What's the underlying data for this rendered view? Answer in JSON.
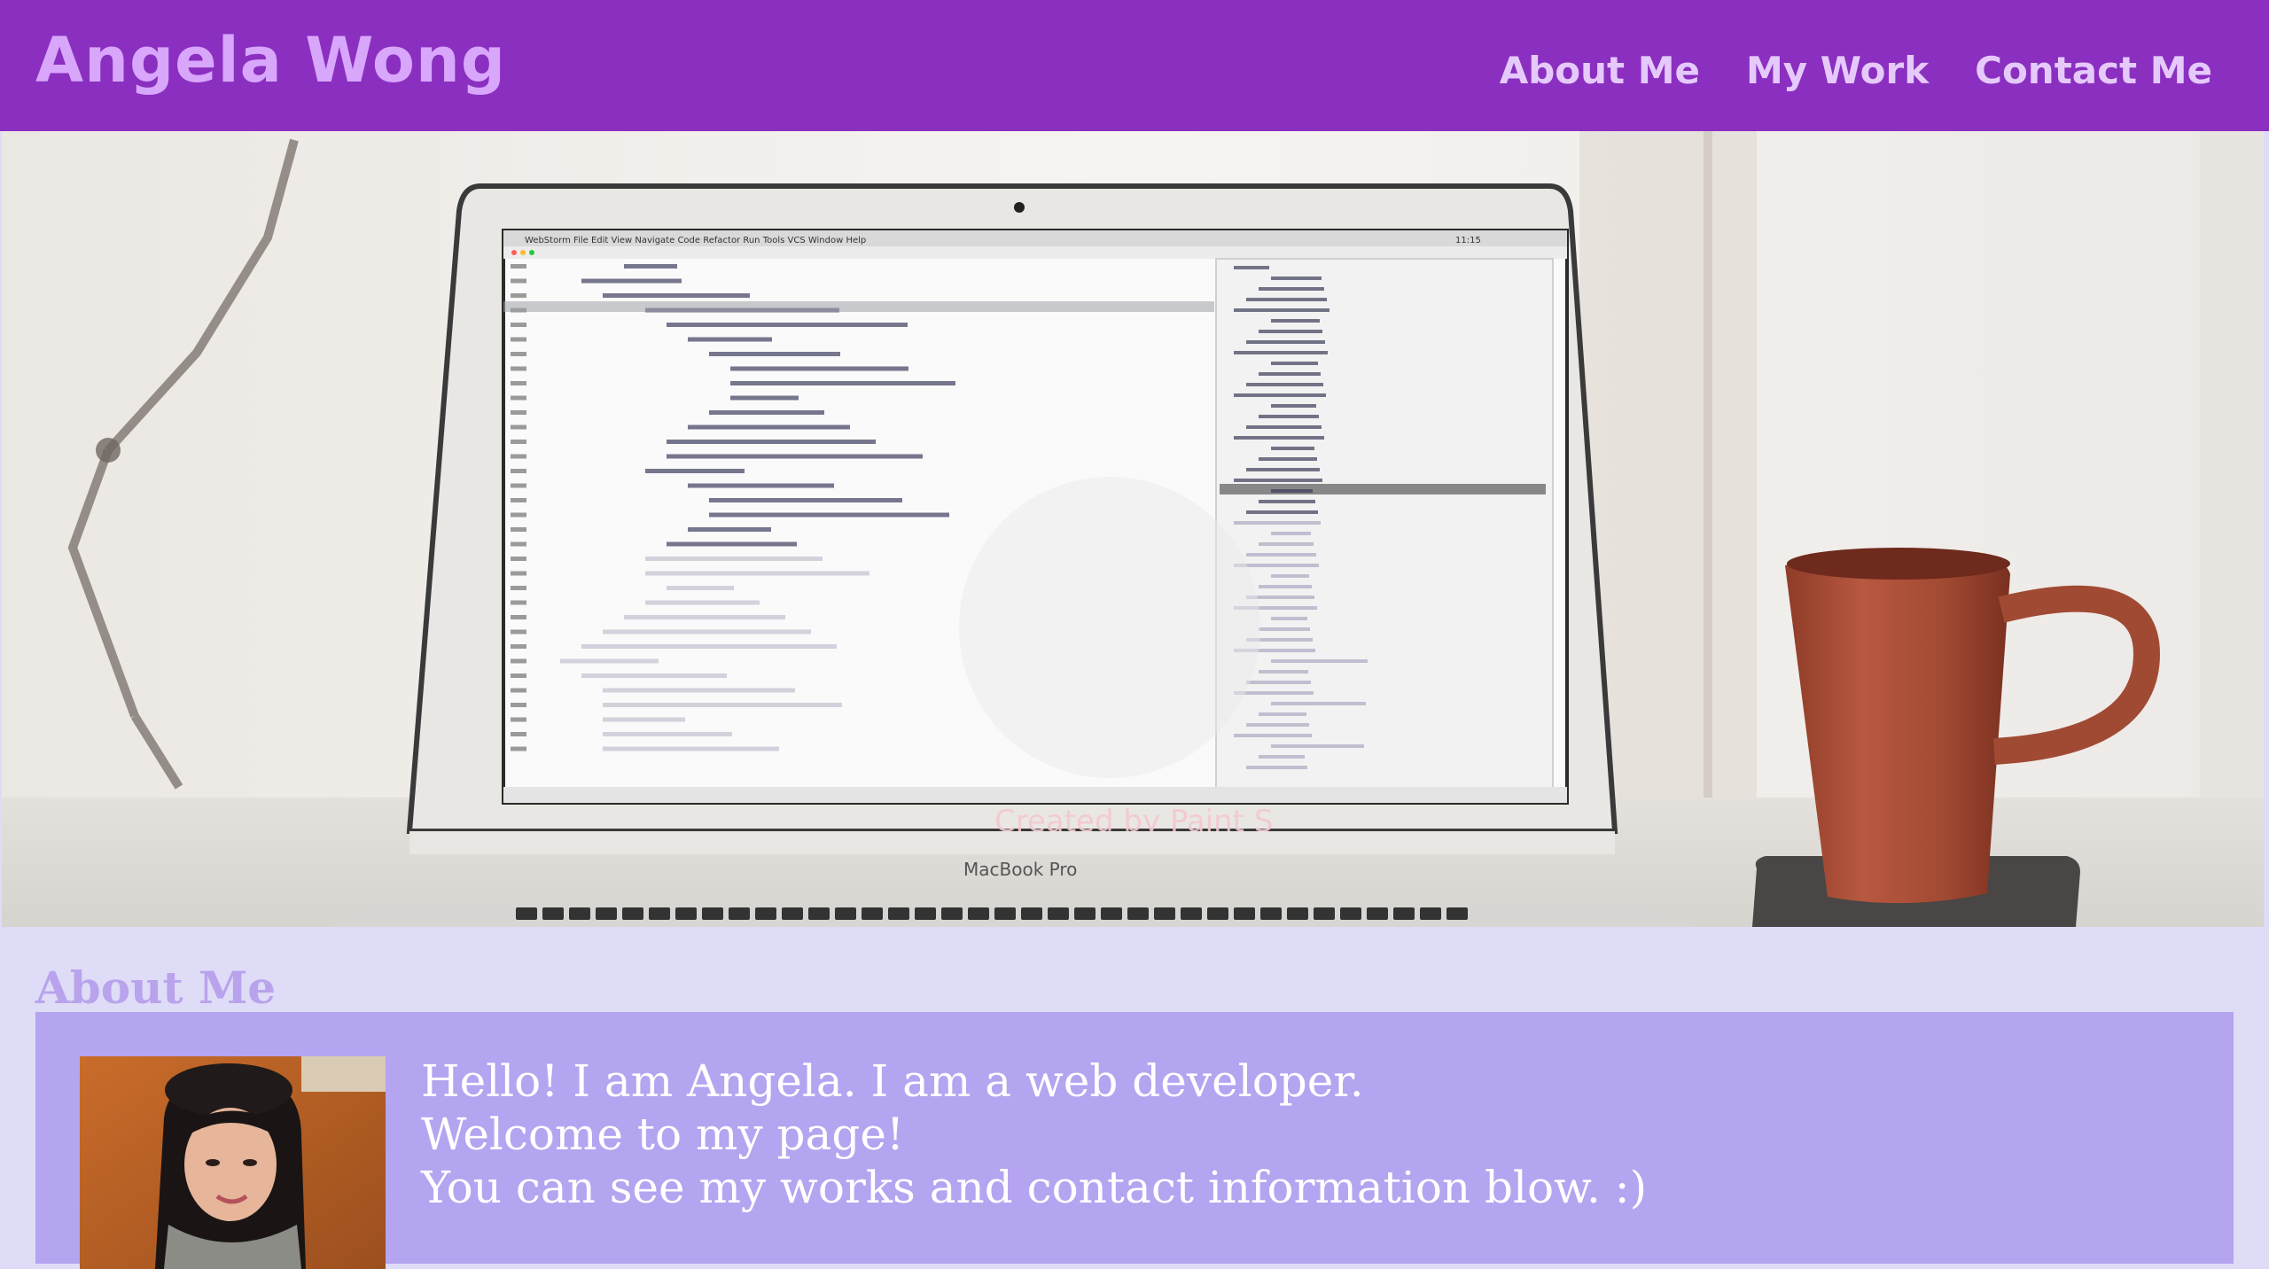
{
  "header": {
    "site_title": "Angela Wong",
    "nav": [
      {
        "label": "About Me"
      },
      {
        "label": "My Work"
      },
      {
        "label": "Contact Me"
      }
    ]
  },
  "hero": {
    "laptop_brand": "MacBook Pro",
    "watermark": "Created by Paint S",
    "menubar_items": [
      "WebStorm",
      "File",
      "Edit",
      "View",
      "Navigate",
      "Code",
      "Refactor",
      "Run",
      "Tools",
      "VCS",
      "Window",
      "Help"
    ],
    "clock": "11:15"
  },
  "about": {
    "heading": "About Me",
    "lines": [
      "Hello! I am Angela. I am a web developer.",
      "Welcome to my page!",
      "You can see my works and contact information blow. :)"
    ]
  },
  "colors": {
    "header_bg": "#8a2fc0",
    "title": "#d8a6fb",
    "nav_text": "#e5c9fb",
    "page_bg": "#dedcf7",
    "card_bg": "#b5a4f0",
    "about_heading": "#b9a3ec"
  }
}
